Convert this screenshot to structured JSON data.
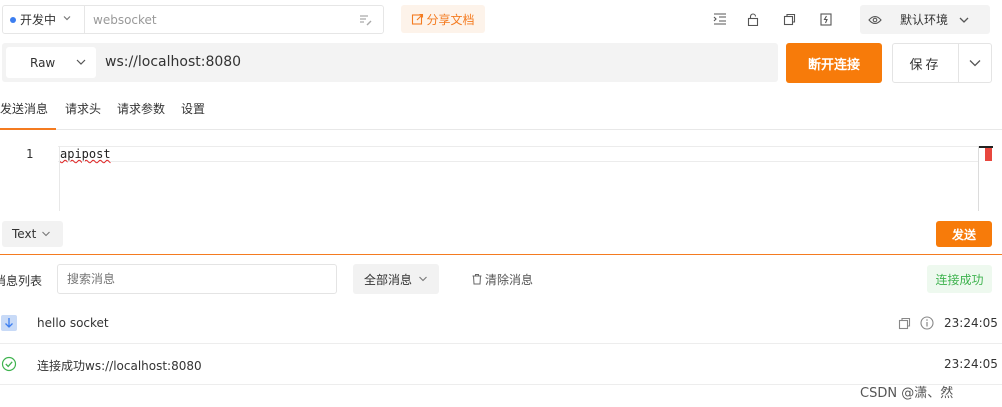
{
  "topbar": {
    "status_label": "开发中",
    "name_value": "websocket",
    "name_placeholder": "websocket",
    "share_label": "分享文档",
    "env_label": "默认环境"
  },
  "request": {
    "method": "Raw",
    "url": "ws://localhost:8080",
    "disconnect_label": "断开连接",
    "save_label": "保存"
  },
  "tabs": [
    {
      "label": "发送消息",
      "active": true
    },
    {
      "label": "请求头",
      "active": false
    },
    {
      "label": "请求参数",
      "active": false
    },
    {
      "label": "设置",
      "active": false
    }
  ],
  "editor": {
    "line_number": "1",
    "content": "apipost"
  },
  "body": {
    "type": "Text",
    "send_label": "发送"
  },
  "messages": {
    "title": "消息列表",
    "search_placeholder": "搜索消息",
    "filter_label": "全部消息",
    "clear_label": "清除消息",
    "status_badge": "连接成功",
    "items": [
      {
        "icon": "arrow-down-icon",
        "text": "hello socket",
        "time": "23:24:05"
      },
      {
        "icon": "check-circle-icon",
        "text": "连接成功ws://localhost:8080",
        "time": "23:24:05"
      }
    ]
  },
  "watermark": "CSDN @潇、然",
  "colors": {
    "accent": "#f77b0a",
    "status_dot": "#3c7ef0",
    "success": "#3fb34f",
    "error_marker": "#e8473e"
  }
}
